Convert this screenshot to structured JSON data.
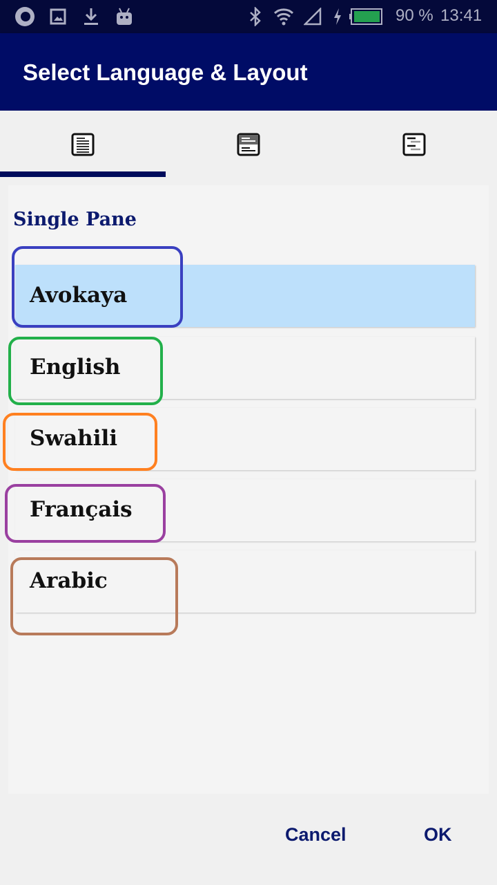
{
  "status_bar": {
    "battery": "90 %",
    "time": "13:41",
    "battery_level": 0.9,
    "icons": [
      "app-logo-icon",
      "image-icon",
      "download-icon",
      "android-icon",
      "bluetooth-icon",
      "wifi-icon",
      "cell-signal-icon",
      "charging-icon",
      "battery-icon"
    ]
  },
  "header": {
    "title": "Select Language & Layout"
  },
  "tabs": [
    {
      "icon": "single-pane-icon",
      "selected": true
    },
    {
      "icon": "two-pane-icon",
      "selected": false
    },
    {
      "icon": "interlinear-icon",
      "selected": false
    }
  ],
  "panel": {
    "title": "Single Pane",
    "items": [
      {
        "label": "Avokaya",
        "selected": true
      },
      {
        "label": "English"
      },
      {
        "label": "Swahili"
      },
      {
        "label": "Français"
      },
      {
        "label": "Arabic"
      }
    ]
  },
  "annotation_colors": [
    "#3a40c0",
    "#22b04a",
    "#ff8020",
    "#9a40a0",
    "#b87a5a"
  ],
  "actions": {
    "cancel": "Cancel",
    "ok": "OK"
  }
}
